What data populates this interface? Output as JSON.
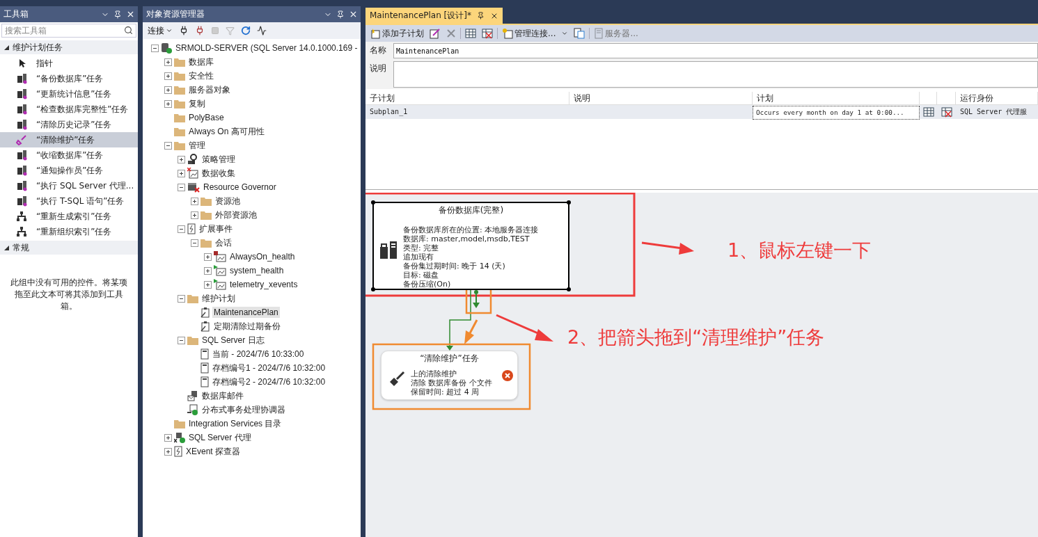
{
  "toolbox": {
    "title": "工具箱",
    "search": {
      "placeholder": "搜索工具箱"
    },
    "groups": [
      {
        "label": "维护计划任务",
        "expanded": true,
        "items": [
          {
            "label": "指针",
            "kind": "pointer",
            "selected": false
          },
          {
            "label": "“备份数据库”任务",
            "kind": "task",
            "selected": false
          },
          {
            "label": "“更新统计信息”任务",
            "kind": "task",
            "selected": false
          },
          {
            "label": "“检查数据库完整性”任务",
            "kind": "task",
            "selected": false
          },
          {
            "label": "“清除历史记录”任务",
            "kind": "task",
            "selected": false
          },
          {
            "label": "“清除维护”任务",
            "kind": "brush",
            "selected": true
          },
          {
            "label": "“收缩数据库”任务",
            "kind": "task",
            "selected": false
          },
          {
            "label": "“通知操作员”任务",
            "kind": "task",
            "selected": false
          },
          {
            "label": "“执行 SQL Server 代理...",
            "kind": "task",
            "selected": false
          },
          {
            "label": "“执行 T-SQL 语句”任务",
            "kind": "task",
            "selected": false
          },
          {
            "label": "“重新生成索引”任务",
            "kind": "hierarchy",
            "selected": false
          },
          {
            "label": "“重新组织索引”任务",
            "kind": "hierarchy",
            "selected": false
          }
        ]
      },
      {
        "label": "常规",
        "expanded": true,
        "empty_text": "此组中没有可用的控件。将某项拖至此文本可将其添加到工具箱。"
      }
    ]
  },
  "explorer": {
    "title": "对象资源管理器",
    "connect": "连接",
    "tree": [
      {
        "label": "SRMOLD-SERVER (SQL Server 14.0.1000.169 -",
        "kind": "server",
        "expanded": true,
        "selected": false,
        "children": [
          {
            "label": "数据库",
            "kind": "folder",
            "expanded": false,
            "selected": false
          },
          {
            "label": "安全性",
            "kind": "folder",
            "expanded": false,
            "selected": false
          },
          {
            "label": "服务器对象",
            "kind": "folder",
            "expanded": false,
            "selected": false
          },
          {
            "label": "复制",
            "kind": "folder",
            "expanded": false,
            "selected": false
          },
          {
            "label": "PolyBase",
            "kind": "folder",
            "selected": false
          },
          {
            "label": "Always On 高可用性",
            "kind": "folder",
            "selected": false
          },
          {
            "label": "管理",
            "kind": "folder",
            "expanded": true,
            "selected": false,
            "children": [
              {
                "label": "策略管理",
                "kind": "policy",
                "expanded": false,
                "selected": false
              },
              {
                "label": "数据收集",
                "kind": "collect",
                "expanded": false,
                "selected": false
              },
              {
                "label": "Resource Governor",
                "kind": "governor",
                "expanded": true,
                "selected": false,
                "children": [
                  {
                    "label": "资源池",
                    "kind": "folder",
                    "expanded": false,
                    "selected": false
                  },
                  {
                    "label": "外部资源池",
                    "kind": "folder",
                    "expanded": false,
                    "selected": false
                  }
                ]
              },
              {
                "label": "扩展事件",
                "kind": "xevent",
                "expanded": true,
                "selected": false,
                "children": [
                  {
                    "label": "会话",
                    "kind": "folder",
                    "expanded": true,
                    "selected": false,
                    "children": [
                      {
                        "label": "AlwaysOn_health",
                        "kind": "session",
                        "running": false,
                        "expanded": false,
                        "selected": false
                      },
                      {
                        "label": "system_health",
                        "kind": "session",
                        "running": true,
                        "expanded": false,
                        "selected": false
                      },
                      {
                        "label": "telemetry_xevents",
                        "kind": "session",
                        "running": true,
                        "expanded": false,
                        "selected": false
                      }
                    ]
                  }
                ]
              },
              {
                "label": "维护计划",
                "kind": "folder",
                "expanded": true,
                "selected": false,
                "children": [
                  {
                    "label": "MaintenancePlan",
                    "kind": "plan",
                    "selected": true
                  },
                  {
                    "label": "定期清除过期备份",
                    "kind": "plan",
                    "selected": false
                  }
                ]
              },
              {
                "label": "SQL Server 日志",
                "kind": "folder",
                "expanded": true,
                "selected": false,
                "children": [
                  {
                    "label": "当前 - 2024/7/6 10:33:00",
                    "kind": "log",
                    "selected": false
                  },
                  {
                    "label": "存档编号1 - 2024/7/6 10:32:00",
                    "kind": "log",
                    "selected": false
                  },
                  {
                    "label": "存档编号2 - 2024/7/6 10:32:00",
                    "kind": "log",
                    "selected": false
                  }
                ]
              },
              {
                "label": "数据库邮件",
                "kind": "mail",
                "selected": false
              },
              {
                "label": "分布式事务处理协调器",
                "kind": "dtc",
                "selected": false
              }
            ]
          },
          {
            "label": "Integration Services 目录",
            "kind": "folder",
            "selected": false
          },
          {
            "label": "SQL Server 代理",
            "kind": "agent",
            "expanded": false,
            "selected": false
          },
          {
            "label": "XEvent 探查器",
            "kind": "xevent",
            "expanded": false,
            "selected": false
          }
        ]
      }
    ]
  },
  "designer": {
    "tab": {
      "title": "MaintenancePlan [设计]*"
    },
    "toolbar": [
      {
        "kind": "add",
        "label": "添加子计划",
        "disabled": false
      },
      {
        "kind": "edit",
        "disabled": false
      },
      {
        "kind": "delete",
        "disabled": true
      },
      {
        "kind": "separator"
      },
      {
        "kind": "grid"
      },
      {
        "kind": "grid-delete"
      },
      {
        "kind": "separator"
      },
      {
        "kind": "connections",
        "label": "管理连接...",
        "disabled": false
      },
      {
        "kind": "report"
      },
      {
        "kind": "separator"
      },
      {
        "kind": "server",
        "label": "服务器...",
        "disabled": true
      }
    ],
    "name": {
      "label": "名称",
      "value": "MaintenancePlan"
    },
    "description": {
      "label": "说明"
    },
    "grid": {
      "columns": [
        {
          "label": "子计划"
        },
        {
          "label": "说明"
        },
        {
          "label": "计划"
        },
        {
          "label": "运行身份"
        }
      ],
      "rows": [
        {
          "subplan": "Subplan_1",
          "schedule": "Occurs every month on day 1 at 0:00...",
          "run_as": "SQL Server 代理服"
        }
      ]
    },
    "canvas": {
      "tasks": [
        {
          "kind": "backup",
          "title": "备份数据库(完整)",
          "selected": true,
          "error": false,
          "lines": [
            "备份数据库所在的位置: 本地服务器连接",
            "数据库: master,model,msdb,TEST",
            "类型: 完整",
            "追加现有",
            "备份集过期时间: 晚于 14 (天)",
            "目标: 磁盘",
            "备份压缩(On)"
          ]
        },
        {
          "kind": "cleanup",
          "title": "“清除维护”任务",
          "selected": false,
          "error": true,
          "lines": [
            "上的清除维护",
            "清除 数据库备份 个文件",
            "保留时间: 超过 4 周"
          ]
        }
      ],
      "annotations": [
        {
          "text": "1、鼠标左键一下"
        },
        {
          "text": "2、把箭头拖到“清理维护”任务"
        }
      ]
    }
  }
}
